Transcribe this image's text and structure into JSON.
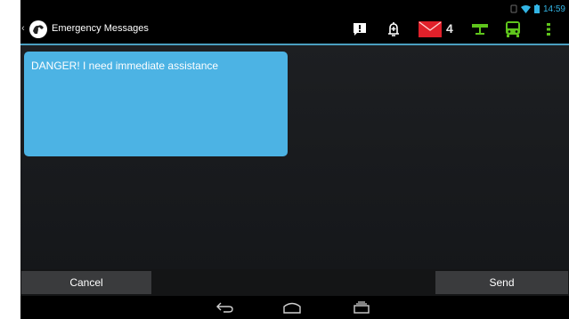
{
  "status_bar": {
    "time": "14:59",
    "icons": [
      "sync-icon",
      "wifi-icon",
      "battery-icon"
    ]
  },
  "action_bar": {
    "title": "Emergency Messages",
    "icons": [
      "alert-message-icon",
      "alarm-bell-icon",
      "mail-icon",
      "network-icon",
      "bus-icon",
      "overflow-menu-icon"
    ],
    "mail_count": "4",
    "colors": {
      "accent": "#4a9fc0",
      "mail": "#e0202a",
      "green": "#5fc51c"
    }
  },
  "message": {
    "text": "DANGER! I need immediate assistance",
    "bg_color": "#4cb3e4"
  },
  "buttons": {
    "cancel": "Cancel",
    "send": "Send"
  },
  "nav_bar": {
    "icons": [
      "back-icon",
      "home-icon",
      "recent-apps-icon"
    ]
  }
}
